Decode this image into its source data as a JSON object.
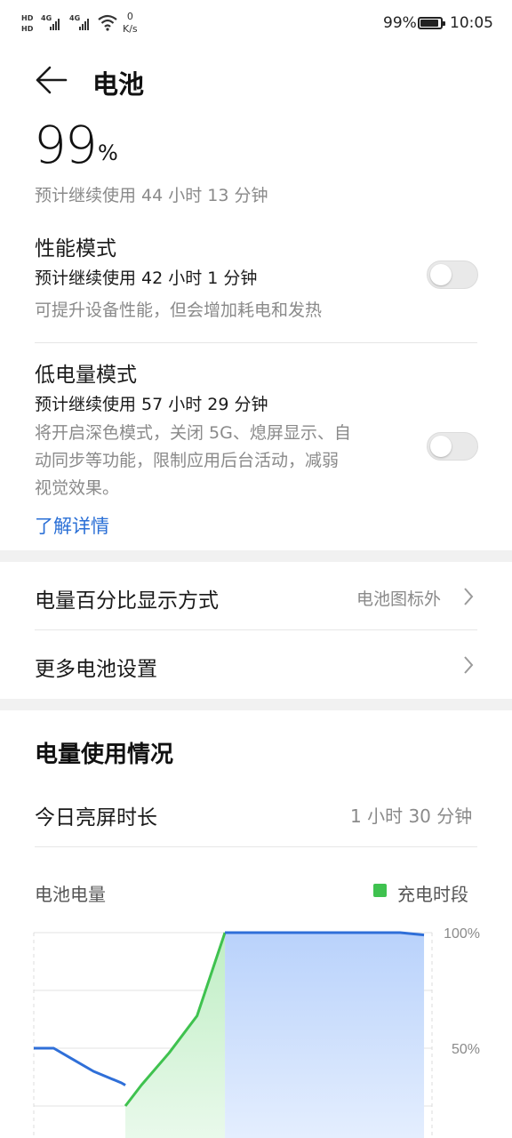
{
  "status_bar": {
    "hd_label_1": "HD",
    "hd_label_2": "HD",
    "net_1": "4G",
    "net_2": "4G",
    "speed_value": "0",
    "speed_unit": "K/s",
    "battery_percent": "99%",
    "battery_level": 0.99,
    "time": "10:05"
  },
  "header": {
    "back_icon": "back-arrow-icon",
    "title": "电池"
  },
  "battery": {
    "level_number": "99",
    "level_unit": "%",
    "estimate": "预计继续使用 44 小时 13 分钟"
  },
  "performance_mode": {
    "title": "性能模式",
    "estimate": "预计继续使用 42 小时 1 分钟",
    "description": "可提升设备性能，但会增加耗电和发热",
    "enabled": false
  },
  "low_power_mode": {
    "title": "低电量模式",
    "estimate": "预计继续使用 57 小时 29 分钟",
    "description_line1": "将开启深色模式，关闭 5G、熄屏显示、自",
    "description_line2": "动同步等功能，限制应用后台活动，减弱",
    "description_line3": "视觉效果。",
    "learn_more": "了解详情",
    "enabled": false
  },
  "settings": {
    "percent_display_label": "电量百分比显示方式",
    "percent_display_value": "电池图标外",
    "more_settings_label": "更多电池设置",
    "chevron_icon": "chevron-right-icon"
  },
  "usage": {
    "section_title": "电量使用情况",
    "screen_on_label": "今日亮屏时长",
    "screen_on_value": "1 小时 30 分钟"
  },
  "chart_data": {
    "type": "line",
    "title": "电池电量",
    "legend": [
      {
        "name": "充电时段",
        "color": "#3fc24f"
      }
    ],
    "yticks": [
      "100%",
      "50%"
    ],
    "ylim": [
      0,
      100
    ],
    "colors": {
      "discharge": "#2f6fd8",
      "charge": "#3fc24f",
      "grid": "#e3e3e3"
    },
    "series": [
      {
        "name": "充电时段",
        "points": [
          [
            0.23,
            25
          ],
          [
            0.27,
            34
          ],
          [
            0.34,
            48
          ],
          [
            0.41,
            64
          ],
          [
            0.48,
            100
          ]
        ]
      },
      {
        "name": "",
        "points": [
          [
            0.0,
            50
          ],
          [
            0.05,
            50
          ],
          [
            0.09,
            46
          ],
          [
            0.15,
            40
          ],
          [
            0.22,
            35
          ],
          [
            0.23,
            34
          ]
        ]
      },
      {
        "name": "",
        "points": [
          [
            0.48,
            100
          ],
          [
            0.92,
            100
          ],
          [
            0.98,
            99
          ]
        ]
      }
    ]
  }
}
